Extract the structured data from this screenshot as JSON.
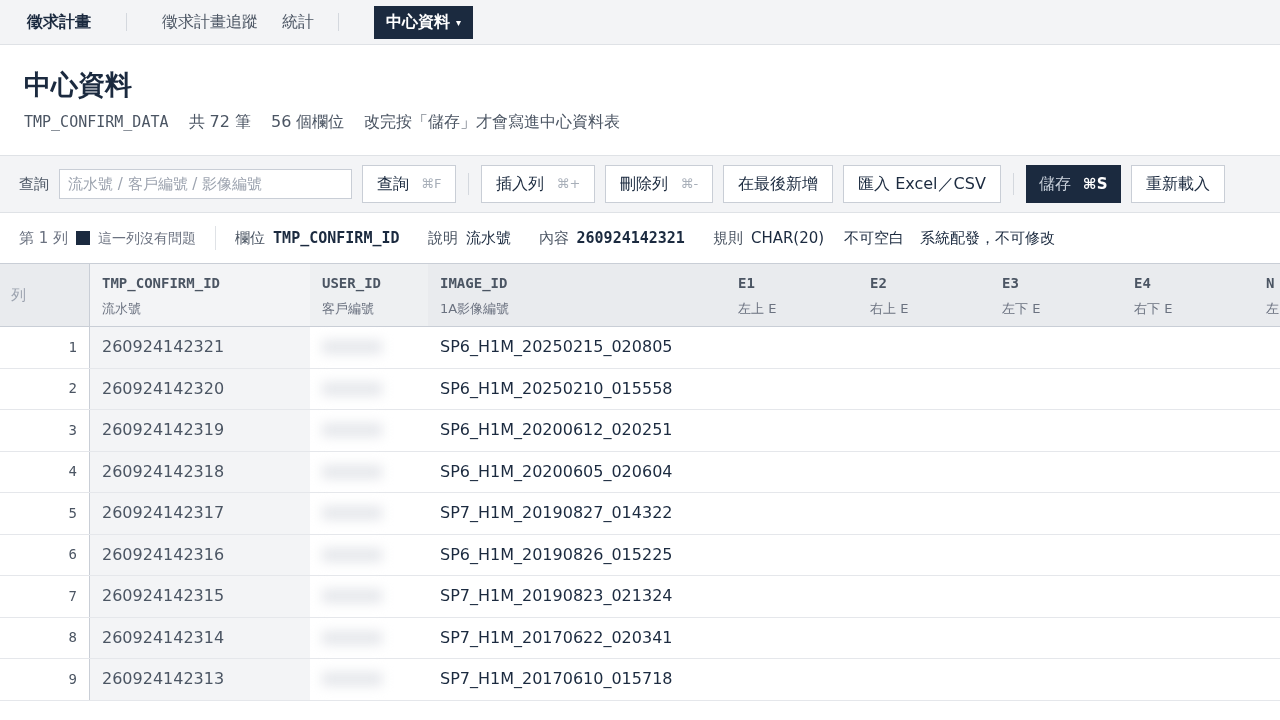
{
  "nav": {
    "brand": "徵求計畫",
    "items": [
      {
        "label": "徵求計畫追蹤",
        "selected": false,
        "divider_before": true
      },
      {
        "label": "統計",
        "selected": false,
        "divider_before": false
      },
      {
        "label": "中心資料",
        "selected": true,
        "divider_before": true,
        "caret": "▾"
      }
    ]
  },
  "page": {
    "title": "中心資料",
    "table_name": "TMP_CONFIRM_DATA",
    "row_count": "共 72 筆",
    "field_count": "56 個欄位",
    "note": "改完按「儲存」才會寫進中心資料表"
  },
  "toolbar": {
    "search_label": "查詢",
    "search_placeholder": "流水號 / 客戶編號 / 影像編號",
    "groups": [
      [
        {
          "label": "查詢",
          "shortcut": "⌘F",
          "kind": "default"
        }
      ],
      [
        {
          "label": "插入列",
          "shortcut": "⌘+",
          "kind": "default"
        },
        {
          "label": "刪除列",
          "shortcut": "⌘-",
          "kind": "default"
        },
        {
          "label": "在最後新增",
          "kind": "default"
        },
        {
          "label": "匯入 Excel／CSV",
          "kind": "default"
        }
      ],
      [
        {
          "label": "儲存",
          "shortcut": "⌘S",
          "kind": "primary"
        },
        {
          "label": "重新載入",
          "kind": "default"
        }
      ]
    ]
  },
  "info": {
    "row_label": "第 1 列",
    "status_ok": true,
    "status": "這一列沒有問題",
    "fields": [
      {
        "label": "欄位",
        "value": "TMP_CONFIRM_ID",
        "kind": "mono"
      },
      {
        "label": "說明",
        "value": "流水號",
        "kind": "plain"
      },
      {
        "label": "內容",
        "value": "260924142321",
        "kind": "mono"
      }
    ],
    "rule_label": "規則",
    "rule": "CHAR(20)",
    "constraints": [
      "不可空白",
      "系統配發，不可修改"
    ]
  },
  "table": {
    "row_header": "列",
    "columns": [
      {
        "name": "TMP_CONFIRM_ID",
        "description": "流水號",
        "kind": "confirm"
      },
      {
        "name": "USER_ID",
        "description": "客戶編號",
        "kind": "blurred"
      },
      {
        "name": "IMAGE_ID",
        "description": "1A影像編號",
        "kind": "image"
      },
      {
        "name": "E1",
        "description": "左上 E",
        "kind": "empty"
      },
      {
        "name": "E2",
        "description": "右上 E",
        "kind": "empty"
      },
      {
        "name": "E3",
        "description": "左下 E",
        "kind": "empty"
      },
      {
        "name": "E4",
        "description": "右下 E",
        "kind": "empty"
      },
      {
        "name": "N",
        "description": "左",
        "kind": "empty"
      }
    ],
    "rows": [
      {
        "number": "1",
        "confirm_id": "260924142321",
        "image_id": "SP6_H1M_20250215_020805"
      },
      {
        "number": "2",
        "confirm_id": "260924142320",
        "image_id": "SP6_H1M_20250210_015558"
      },
      {
        "number": "3",
        "confirm_id": "260924142319",
        "image_id": "SP6_H1M_20200612_020251"
      },
      {
        "number": "4",
        "confirm_id": "260924142318",
        "image_id": "SP6_H1M_20200605_020604"
      },
      {
        "number": "5",
        "confirm_id": "260924142317",
        "image_id": "SP7_H1M_20190827_014322"
      },
      {
        "number": "6",
        "confirm_id": "260924142316",
        "image_id": "SP6_H1M_20190826_015225"
      },
      {
        "number": "7",
        "confirm_id": "260924142315",
        "image_id": "SP7_H1M_20190823_021324"
      },
      {
        "number": "8",
        "confirm_id": "260924142314",
        "image_id": "SP7_H1M_20170622_020341"
      },
      {
        "number": "9",
        "confirm_id": "260924142313",
        "image_id": "SP7_H1M_20170610_015718"
      }
    ]
  }
}
